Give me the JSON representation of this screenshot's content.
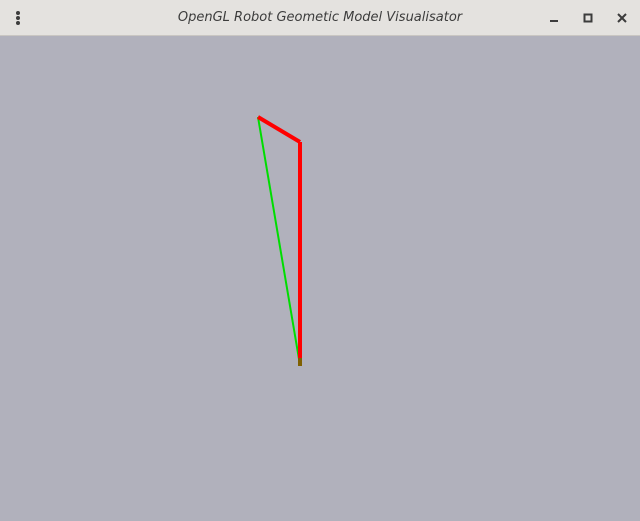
{
  "window": {
    "title": "OpenGL Robot Geometic Model Visualisator"
  },
  "controls": {
    "menu_icon": "kebab-menu-icon",
    "minimize_icon": "minimize-icon",
    "maximize_icon": "maximize-icon",
    "close_icon": "close-icon"
  },
  "scene": {
    "background_color": "#b1b1bc",
    "link_color": "#ff0000",
    "ray_color": "#00dd00",
    "joint_color": "#806000"
  }
}
